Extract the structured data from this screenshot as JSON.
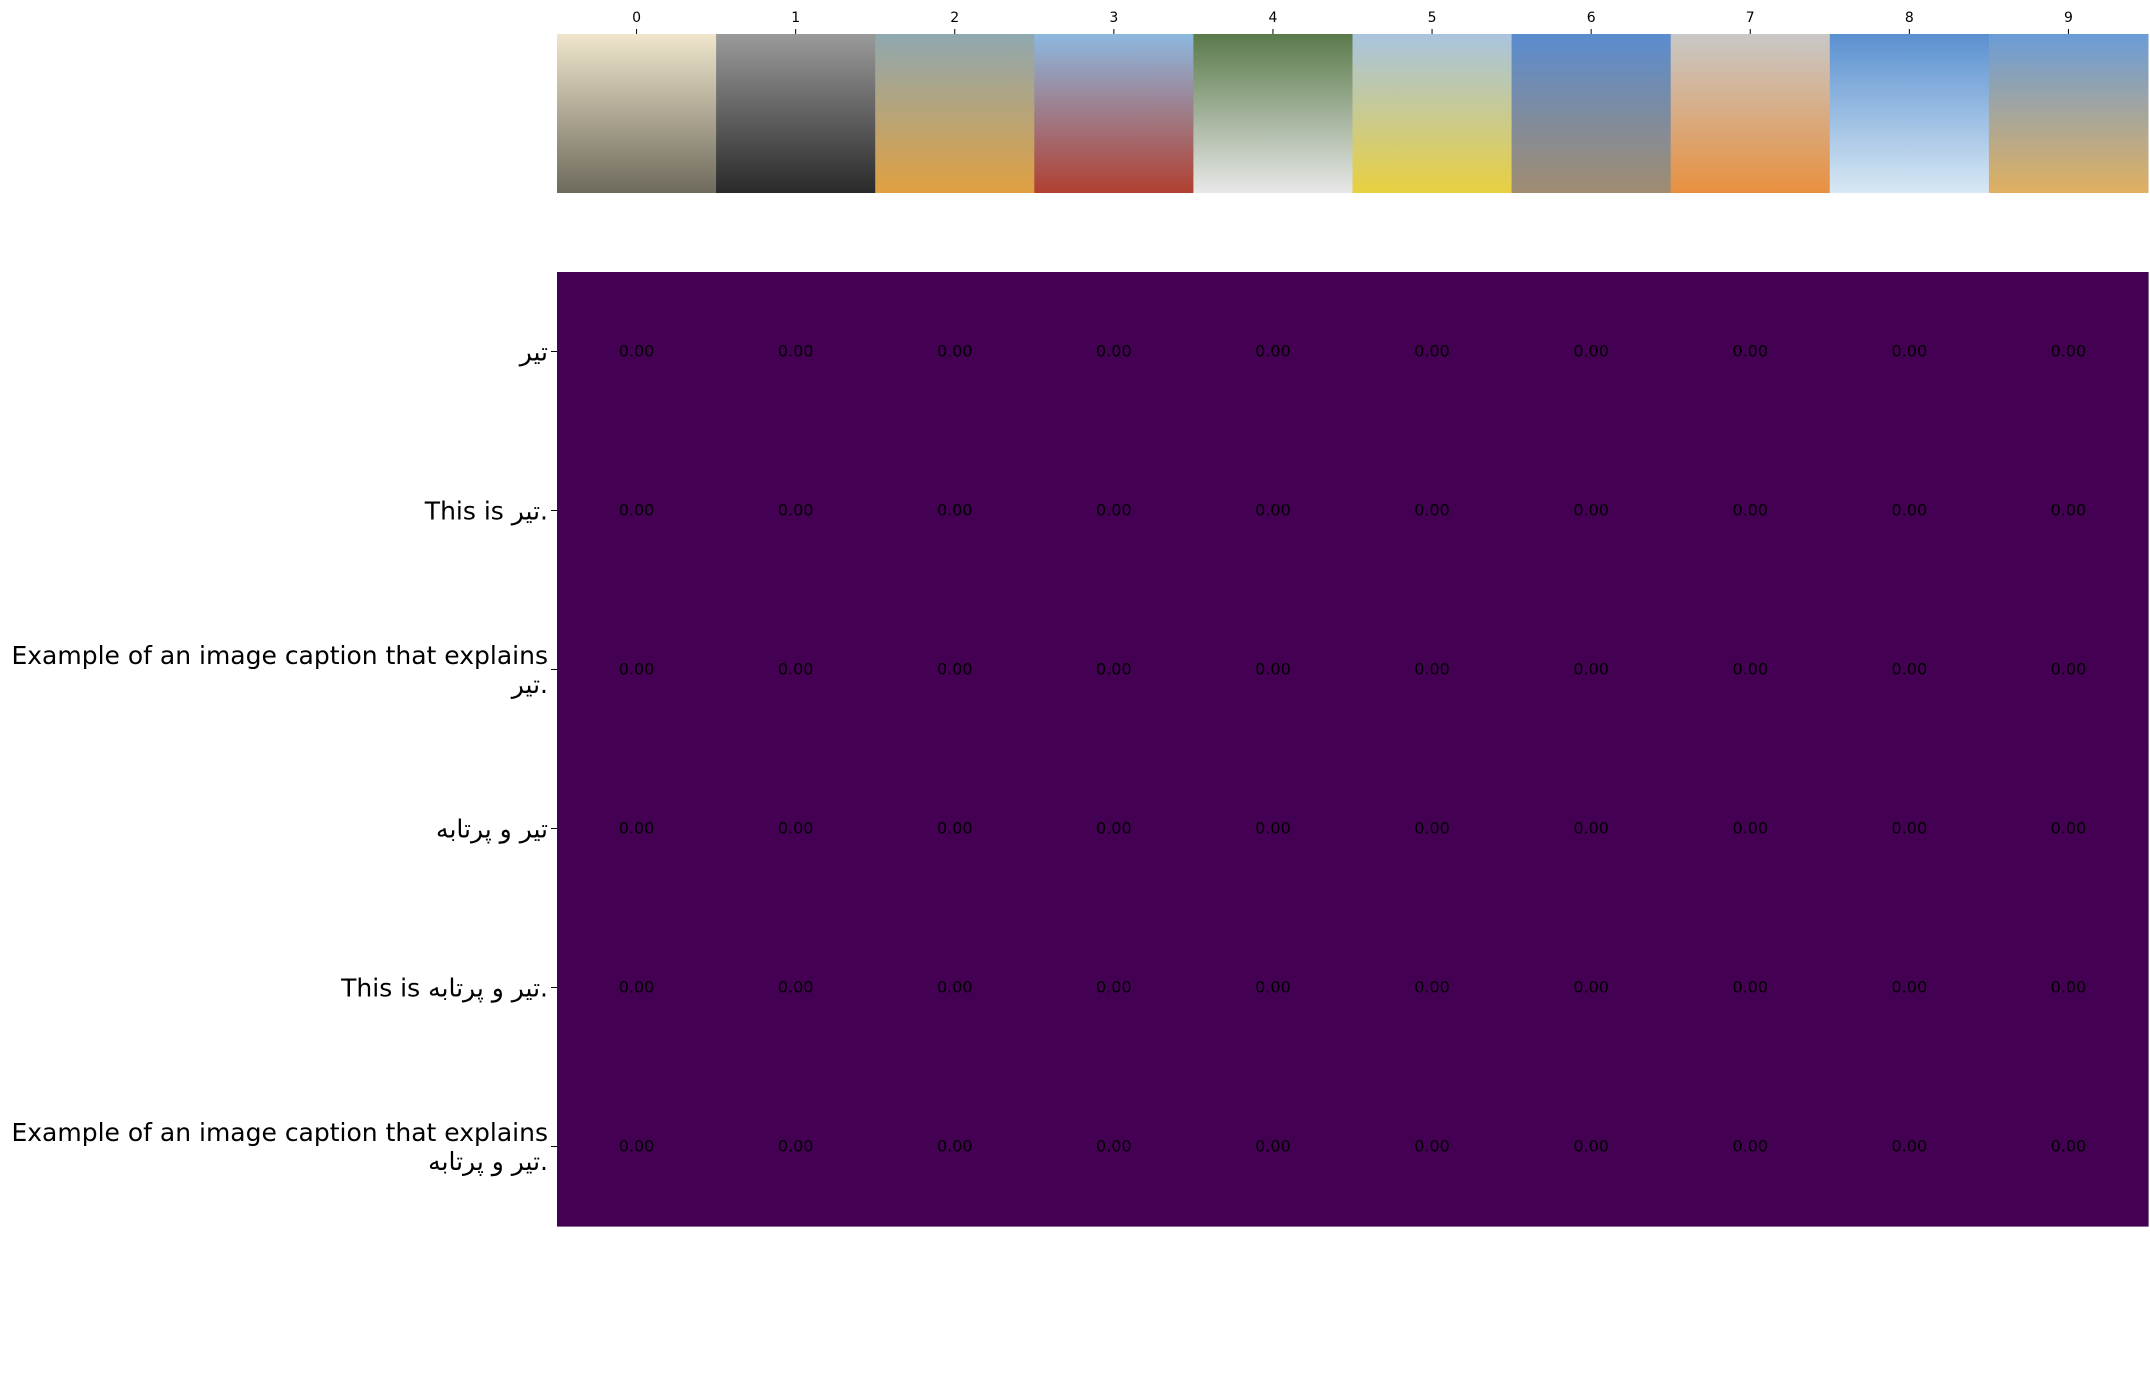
{
  "chart_data": {
    "type": "heatmap",
    "title": "",
    "xlabel": "",
    "ylabel": "",
    "colormap": "viridis",
    "cell_color": "#440154",
    "annotation_color": "#000000",
    "value_format": "0.00",
    "columns": [
      "0",
      "1",
      "2",
      "3",
      "4",
      "5",
      "6",
      "7",
      "8",
      "9"
    ],
    "column_images": [
      {
        "name": "arrow-drawings-image",
        "palette": [
          "#efe6cc",
          "#6e6a5c"
        ]
      },
      {
        "name": "diver-shipwreck-image",
        "palette": [
          "#9a9a9a",
          "#2a2a2a"
        ]
      },
      {
        "name": "rocket-launcher-truck-image",
        "palette": [
          "#8fa8b0",
          "#e0a040"
        ]
      },
      {
        "name": "radio-tower-image",
        "palette": [
          "#8cb8e0",
          "#b04030"
        ]
      },
      {
        "name": "kids-playing-field-image",
        "palette": [
          "#5a7a4a",
          "#e8e8e8"
        ]
      },
      {
        "name": "missile-launch-desert-image",
        "palette": [
          "#a8c4e0",
          "#e8d040"
        ]
      },
      {
        "name": "utility-pole-desert-image",
        "palette": [
          "#5a8cd0",
          "#a08c70"
        ]
      },
      {
        "name": "shuttle-launch-smoke-image",
        "palette": [
          "#c8c8c8",
          "#e89040"
        ]
      },
      {
        "name": "power-lines-collage-image",
        "palette": [
          "#5a90d0",
          "#d8e8f4"
        ]
      },
      {
        "name": "soyuz-rocket-launch-image",
        "palette": [
          "#6a9cd8",
          "#e0b060"
        ]
      }
    ],
    "rows": [
      [
        "تیر"
      ],
      [
        "This is تیر."
      ],
      [
        "Example of an image caption that explains",
        "تیر."
      ],
      [
        "تیر و پرتابه"
      ],
      [
        "This is تیر و پرتابه."
      ],
      [
        "Example of an image caption that explains",
        "تیر و پرتابه."
      ]
    ],
    "values": [
      [
        0,
        0,
        0,
        0,
        0,
        0,
        0,
        0,
        0,
        0
      ],
      [
        0,
        0,
        0,
        0,
        0,
        0,
        0,
        0,
        0,
        0
      ],
      [
        0,
        0,
        0,
        0,
        0,
        0,
        0,
        0,
        0,
        0
      ],
      [
        0,
        0,
        0,
        0,
        0,
        0,
        0,
        0,
        0,
        0
      ],
      [
        0,
        0,
        0,
        0,
        0,
        0,
        0,
        0,
        0,
        0
      ],
      [
        0,
        0,
        0,
        0,
        0,
        0,
        0,
        0,
        0,
        0
      ]
    ],
    "grid": false,
    "legend": "none"
  }
}
